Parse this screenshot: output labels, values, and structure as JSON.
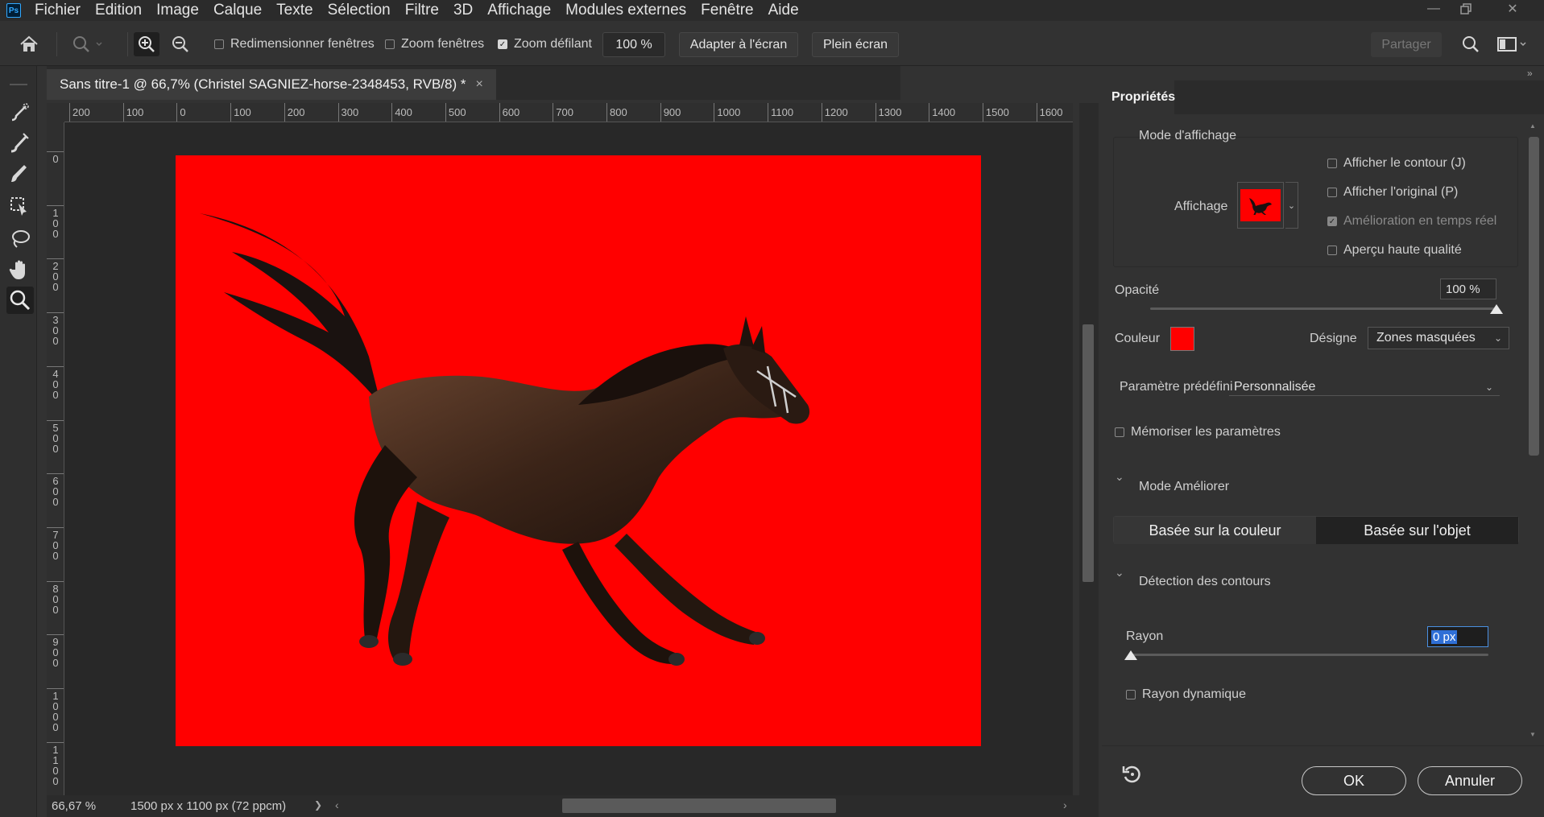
{
  "app": {
    "logo": "Ps"
  },
  "menu": [
    "Fichier",
    "Edition",
    "Image",
    "Calque",
    "Texte",
    "Sélection",
    "Filtre",
    "3D",
    "Affichage",
    "Modules externes",
    "Fenêtre",
    "Aide"
  ],
  "options": {
    "resize_windows": "Redimensionner fenêtres",
    "zoom_windows": "Zoom fenêtres",
    "scrubby_zoom": "Zoom défilant",
    "zoom_value": "100 %",
    "fit_screen": "Adapter à l'écran",
    "full_screen": "Plein écran",
    "share": "Partager"
  },
  "document": {
    "tab_title": "Sans titre-1 @ 66,7% (Christel SAGNIEZ-horse-2348453, RVB/8) *",
    "close": "×"
  },
  "ruler": {
    "h_labels": [
      "200",
      "100",
      "0",
      "100",
      "200",
      "300",
      "400",
      "500",
      "600",
      "700",
      "800",
      "900",
      "1000",
      "1100",
      "1200",
      "1300",
      "1400",
      "1500",
      "1600"
    ],
    "v_labels": [
      "0",
      "1\n0\n0",
      "2\n0\n0",
      "3\n0\n0",
      "4\n0\n0",
      "5\n0\n0",
      "6\n0\n0",
      "7\n0\n0",
      "8\n0\n0",
      "9\n0\n0",
      "1\n0\n0\n0",
      "1\n1\n0\n0"
    ]
  },
  "status": {
    "zoom": "66,67 %",
    "doc_size": "1500 px x 1100 px (72 ppcm)",
    "arrow": "❯"
  },
  "panel": {
    "tab": "Propriétés",
    "view_mode_title": "Mode d'affichage",
    "affichage_label": "Affichage",
    "show_edge": "Afficher le contour (J)",
    "show_original": "Afficher l'original (P)",
    "realtime": "Amélioration en temps réel",
    "hq_preview": "Aperçu haute qualité",
    "opacity_label": "Opacité",
    "opacity_value": "100 %",
    "opacity_level": 1.0,
    "color_label": "Couleur",
    "color_value": "#ff0000",
    "indicates_label": "Désigne",
    "indicates_value": "Zones masquées",
    "preset_label": "Paramètre prédéfini",
    "preset_value": "Personnalisée",
    "remember": "Mémoriser les paramètres",
    "refine_mode": "Mode Améliorer",
    "color_aware": "Basée sur la couleur",
    "object_aware": "Basée sur l'objet",
    "edge_detection": "Détection des contours",
    "radius_label": "Rayon",
    "radius_value": "0 px",
    "radius_level": 0,
    "smart_radius": "Rayon dynamique",
    "ok": "OK",
    "cancel": "Annuler"
  },
  "colors": {
    "accent": "#31a8ff",
    "mask": "#ff0000"
  }
}
